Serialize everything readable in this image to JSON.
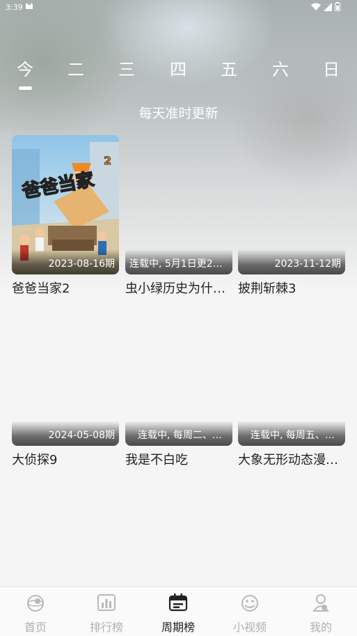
{
  "status_bar": {
    "time": "3:39"
  },
  "day_tabs": [
    {
      "label": "今",
      "active": true
    },
    {
      "label": "二",
      "active": false
    },
    {
      "label": "三",
      "active": false
    },
    {
      "label": "四",
      "active": false
    },
    {
      "label": "五",
      "active": false
    },
    {
      "label": "六",
      "active": false
    },
    {
      "label": "日",
      "active": false
    }
  ],
  "subtitle": "每天准时更新",
  "cards": [
    {
      "title": "爸爸当家2",
      "badge": "2023-08-16期"
    },
    {
      "title": "虫小绿历史为什…",
      "badge": "连载中, 5月1日更2…"
    },
    {
      "title": "披荆斩棘3",
      "badge": "2023-11-12期"
    },
    {
      "title": "大侦探9",
      "badge": "2024-05-08期"
    },
    {
      "title": "我是不白吃",
      "badge": "连载中, 每周二、…"
    },
    {
      "title": "大象无形动态漫…",
      "badge": "连载中, 每周五、…"
    }
  ],
  "poster_art": {
    "text": "爸爸当家",
    "accent": "#f08a24"
  },
  "bottom_nav": [
    {
      "label": "首页",
      "icon": "home-globe-icon",
      "active": false
    },
    {
      "label": "排行榜",
      "icon": "ranking-chart-icon",
      "active": false
    },
    {
      "label": "周期榜",
      "icon": "calendar-icon",
      "active": true
    },
    {
      "label": "小视频",
      "icon": "small-video-icon",
      "active": false
    },
    {
      "label": "我的",
      "icon": "profile-icon",
      "active": false
    }
  ]
}
